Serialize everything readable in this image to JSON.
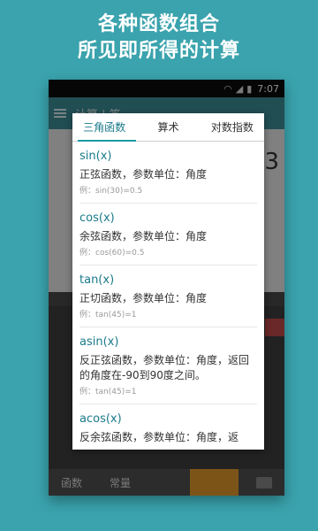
{
  "promo": {
    "line1": "各种函数组合",
    "line2": "所见即所得的计算"
  },
  "status_bar": {
    "time": "7:07",
    "icons": [
      "wifi-icon",
      "signal-icon",
      "battery-icon"
    ]
  },
  "background_app": {
    "appbar_title": "计算 | 签",
    "display_digit": "3",
    "bottom_labels": [
      "函数",
      "常量"
    ]
  },
  "dialog": {
    "tabs": [
      {
        "label": "三角函数",
        "active": true
      },
      {
        "label": "算术",
        "active": false
      },
      {
        "label": "对数指数",
        "active": false
      }
    ],
    "items": [
      {
        "fn": "sin(x)",
        "desc": "正弦函数，参数单位：角度",
        "example": "例：sin(30)=0.5"
      },
      {
        "fn": "cos(x)",
        "desc": "余弦函数，参数单位：角度",
        "example": "例：cos(60)=0.5"
      },
      {
        "fn": "tan(x)",
        "desc": "正切函数，参数单位：角度",
        "example": "例：tan(45)=1"
      },
      {
        "fn": "asin(x)",
        "desc": "反正弦函数，参数单位：角度，返回的角度在-90到90度之间。",
        "example": "例：tan(45)=1"
      },
      {
        "fn": "acos(x)",
        "desc": "反余弦函数，参数单位：角度，返",
        "example": ""
      }
    ]
  },
  "colors": {
    "page_bg": "#3aa3ad",
    "accent": "#1a7a8a",
    "tab_underline": "#1a9aa8"
  }
}
